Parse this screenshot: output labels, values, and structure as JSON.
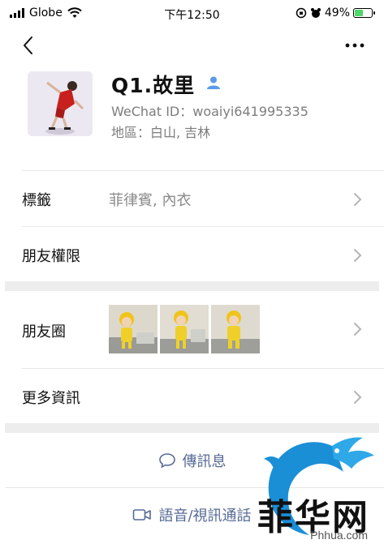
{
  "status_bar": {
    "carrier": "Globe",
    "time": "下午12:50",
    "battery": "49%",
    "battery_level": 0.49
  },
  "nav": {
    "back_icon": "chevron-left-icon",
    "more_icon": "ellipsis-icon"
  },
  "profile": {
    "name": "Q1.故里",
    "wechat_id": "WeChat ID：woaiyi641995335",
    "region": "地區：白山, 吉林"
  },
  "rows": {
    "tags": {
      "label": "標籤",
      "value": "菲律賓, 內衣"
    },
    "privacy": {
      "label": "朋友權限"
    },
    "moments": {
      "label": "朋友圈"
    },
    "more_info": {
      "label": "更多資訊"
    }
  },
  "actions": {
    "message": "傳訊息",
    "call": "語音/視訊通話"
  },
  "watermark": {
    "text": "菲华网",
    "url": "Phhua.com"
  },
  "colors": {
    "link_blue": "#576b95",
    "gray_text": "#7d7d7d",
    "separator": "#ededed"
  }
}
